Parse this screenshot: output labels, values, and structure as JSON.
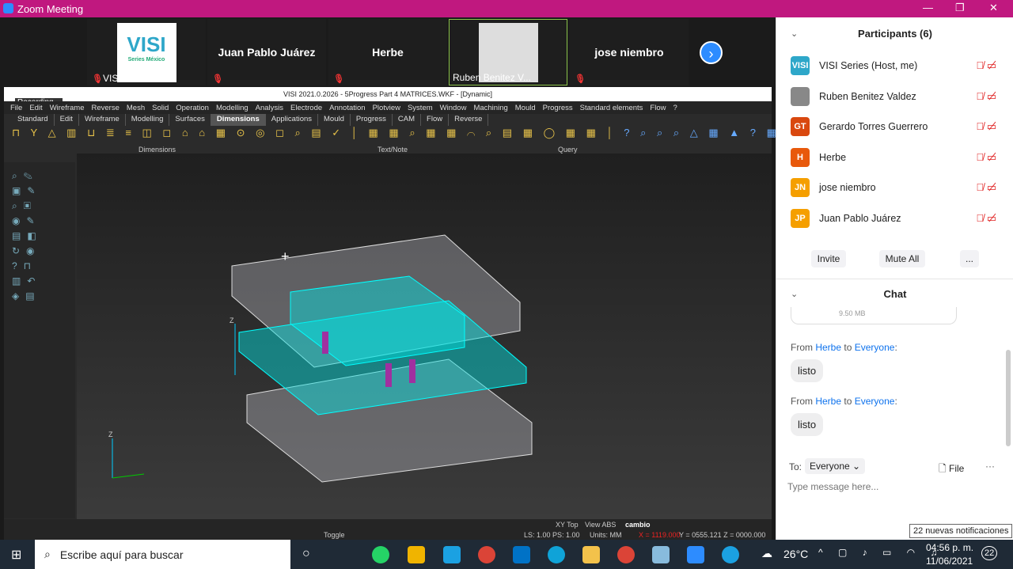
{
  "window": {
    "title": "Zoom Meeting",
    "minimize": "—",
    "restore": "❐",
    "close": "✕"
  },
  "video_strip": {
    "tiles": [
      {
        "name": "VISI Series",
        "logo": "VISI",
        "logo_sub": "Series México"
      },
      {
        "name": "Juan Pablo Juárez"
      },
      {
        "name": "Herbe"
      },
      {
        "name": "Ruben Benitez V..."
      },
      {
        "name": "jose niembro"
      }
    ],
    "next_icon": "chevron-right-icon"
  },
  "visi": {
    "title": "VISI 2021.0.2026 - 5Progress Part 4 MATRICES.WKF - [Dynamic]",
    "recording": "Recording...",
    "menu": [
      "File",
      "Edit",
      "Wireframe",
      "Reverse",
      "Mesh",
      "Solid",
      "Operation",
      "Modelling",
      "Analysis",
      "Electrode",
      "Annotation",
      "Plotview",
      "System",
      "Window",
      "Machining",
      "Mould",
      "Progress",
      "Standard elements",
      "Flow",
      "?"
    ],
    "tabs": [
      "Standard",
      "Edit",
      "Wireframe",
      "Modelling",
      "Surfaces",
      "Dimensions",
      "Applications",
      "Mould",
      "Progress",
      "CAM",
      "Flow",
      "Reverse"
    ],
    "active_tab": "Dimensions",
    "groups": [
      "Dimensions",
      "Text/Note",
      "Query"
    ],
    "status": {
      "toggle": "Toggle",
      "view": "XY Top",
      "view_abs": "View ABS",
      "layer": "cambio",
      "ls_ps": "LS: 1.00 PS: 1.00",
      "units": "Units: MM",
      "x": "X = 1119.000",
      "yz": "Y = 0555.121 Z = 0000.000"
    },
    "axis_z": "Z"
  },
  "panel": {
    "participants_title": "Participants (6)",
    "participants": [
      {
        "initials": "VISI",
        "name": "VISI Series (Host, me)",
        "color": "#2ea7c9"
      },
      {
        "initials": "",
        "name": "Ruben Benitez Valdez",
        "color": "#888888"
      },
      {
        "initials": "GT",
        "name": "Gerardo Torres Guerrero",
        "color": "#d9480f"
      },
      {
        "initials": "H",
        "name": "Herbe",
        "color": "#e8590c"
      },
      {
        "initials": "JN",
        "name": "jose niembro",
        "color": "#f59f00"
      },
      {
        "initials": "JP",
        "name": "Juan Pablo Juárez",
        "color": "#f59f00"
      }
    ],
    "invite": "Invite",
    "mute_all": "Mute All",
    "more": "...",
    "chat_title": "Chat",
    "file_size": "9.50 MB",
    "messages": [
      {
        "from": "Herbe",
        "to": "Everyone",
        "text": "listo"
      },
      {
        "from": "Herbe",
        "to": "Everyone",
        "text": "listo"
      }
    ],
    "from_label": "From",
    "to_label": "to",
    "to_field_label": "To:",
    "to_value": "Everyone",
    "file": "File",
    "placeholder": "Type message here...",
    "notifications": "22 nuevas notificaciones"
  },
  "taskbar": {
    "search_placeholder": "Escribe aquí para buscar",
    "temp": "26°C",
    "time": "04:56 p. m.",
    "date": "11/06/2021",
    "notif_count": "22"
  }
}
